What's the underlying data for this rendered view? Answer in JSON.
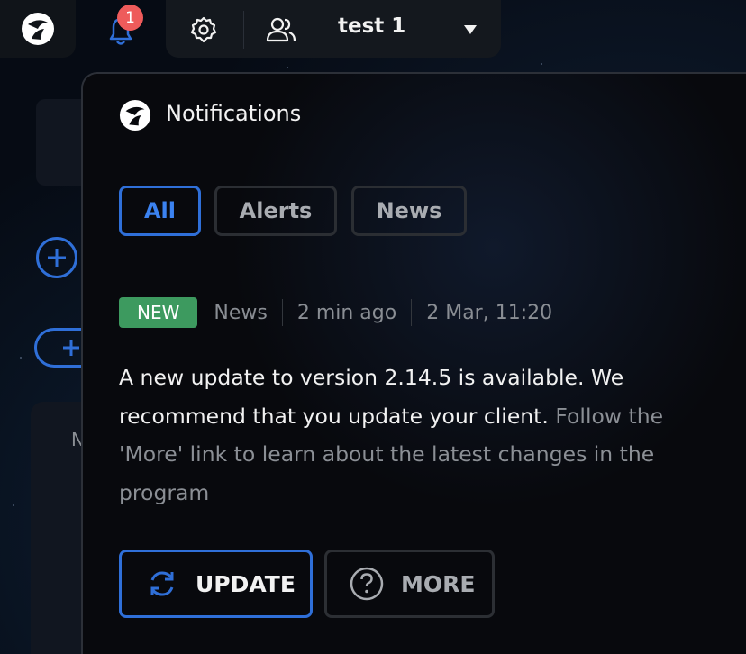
{
  "topbar": {
    "notification_count": "1",
    "profile_name": "test 1"
  },
  "background": {
    "partial_label": "N"
  },
  "notifications": {
    "title": "Notifications",
    "tabs": [
      {
        "label": "All",
        "active": true
      },
      {
        "label": "Alerts",
        "active": false
      },
      {
        "label": "News",
        "active": false
      }
    ],
    "item": {
      "tag": "NEW",
      "category": "News",
      "relative_time": "2 min ago",
      "datetime": "2 Mar, 11:20",
      "message_main": "A new update to version 2.14.5 is available. We recommend that you update your client.",
      "message_hint": "Follow the 'More' link to learn about the latest changes in the program"
    },
    "actions": {
      "update_label": "UPDATE",
      "more_label": "MORE"
    }
  },
  "colors": {
    "accent": "#2f6fd8",
    "badge": "#ee5b5b",
    "new_tag": "#3d9a5f"
  },
  "icons": [
    "app-logo-icon",
    "bell-icon",
    "gear-icon",
    "users-icon",
    "chevron-down-icon",
    "refresh-icon",
    "question-icon",
    "plus-icon"
  ]
}
